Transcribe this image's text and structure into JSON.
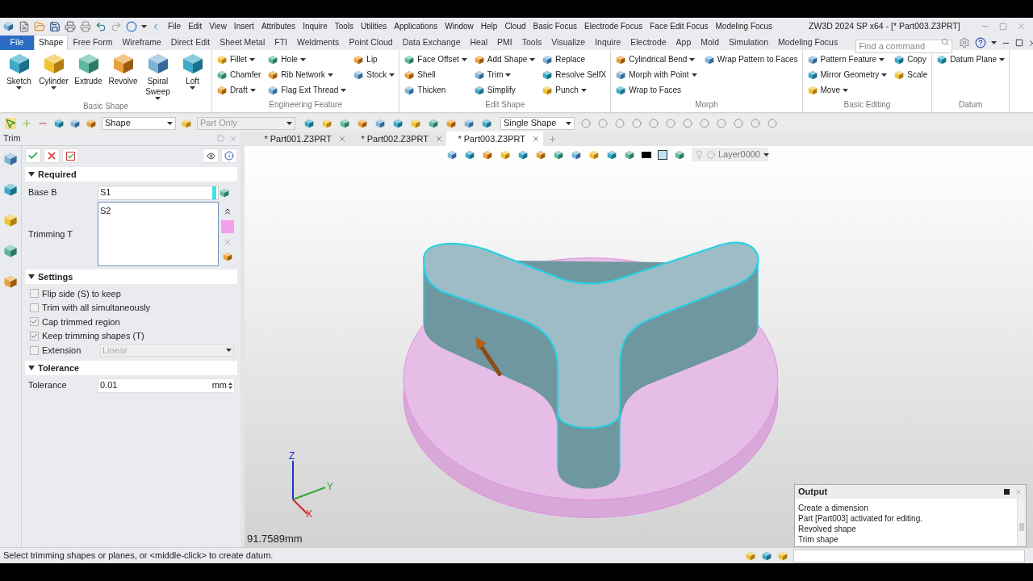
{
  "window": {
    "title": "ZW3D 2024 SP x64 - [* Part003.Z3PRT]"
  },
  "menu": [
    "File",
    "Edit",
    "View",
    "Insert",
    "Attributes",
    "Inquire",
    "Tools",
    "Utilities",
    "Applications",
    "Window",
    "Help",
    "Cloud",
    "Basic Focus",
    "Electrode Focus",
    "Face Edit Focus",
    "Modeling Focus"
  ],
  "ribbon_tabs": [
    {
      "label": "File",
      "kind": "app",
      "selected": false
    },
    {
      "label": "Shape",
      "kind": "tab",
      "selected": true
    },
    {
      "label": "Free Form",
      "kind": "tab",
      "selected": false
    },
    {
      "label": "Wireframe",
      "kind": "tab",
      "selected": false
    },
    {
      "label": "Direct Edit",
      "kind": "tab",
      "selected": false
    },
    {
      "label": "Sheet Metal",
      "kind": "tab",
      "selected": false
    },
    {
      "label": "FTI",
      "kind": "tab",
      "selected": false
    },
    {
      "label": "Weldments",
      "kind": "tab",
      "selected": false
    },
    {
      "label": "Point Cloud",
      "kind": "tab",
      "selected": false
    },
    {
      "label": "Data Exchange",
      "kind": "tab",
      "selected": false
    },
    {
      "label": "Heal",
      "kind": "tab",
      "selected": false
    },
    {
      "label": "PMI",
      "kind": "tab",
      "selected": false
    },
    {
      "label": "Tools",
      "kind": "tab",
      "selected": false
    },
    {
      "label": "Visualize",
      "kind": "tab",
      "selected": false
    },
    {
      "label": "Inquire",
      "kind": "tab",
      "selected": false
    },
    {
      "label": "Electrode",
      "kind": "tab",
      "selected": false
    },
    {
      "label": "App",
      "kind": "tab",
      "selected": false
    },
    {
      "label": "Mold",
      "kind": "tab",
      "selected": false
    },
    {
      "label": "Simulation",
      "kind": "tab",
      "selected": false
    },
    {
      "label": "Modeling Focus",
      "kind": "tab",
      "selected": false
    }
  ],
  "search": {
    "placeholder": "Find a command"
  },
  "ribbon_groups": [
    {
      "title": "Basic Shape",
      "kind": "large",
      "items": [
        {
          "label": "Sketch",
          "dropdown": true
        },
        {
          "label": "Cylinder",
          "dropdown": true
        },
        {
          "label": "Extrude",
          "dropdown": false
        },
        {
          "label": "Revolve",
          "dropdown": false
        },
        {
          "label": "Spiral Sweep",
          "dropdown": true
        },
        {
          "label": "Loft",
          "dropdown": true
        }
      ]
    },
    {
      "title": "Engineering Feature",
      "kind": "small",
      "columns": [
        [
          {
            "label": "Fillet",
            "dropdown": true
          },
          {
            "label": "Chamfer",
            "dropdown": false
          },
          {
            "label": "Draft",
            "dropdown": true
          }
        ],
        [
          {
            "label": "Hole",
            "dropdown": true
          },
          {
            "label": "Rib Network",
            "dropdown": true
          },
          {
            "label": "Flag Ext Thread",
            "dropdown": true
          }
        ],
        [
          {
            "label": "Lip",
            "dropdown": false
          },
          {
            "label": "Stock",
            "dropdown": true
          }
        ]
      ]
    },
    {
      "title": "Edit Shape",
      "kind": "small",
      "columns": [
        [
          {
            "label": "Face Offset",
            "dropdown": true
          },
          {
            "label": "Shell",
            "dropdown": false
          },
          {
            "label": "Thicken",
            "dropdown": false
          }
        ],
        [
          {
            "label": "Add Shape",
            "dropdown": true
          },
          {
            "label": "Trim",
            "dropdown": true
          },
          {
            "label": "Simplify",
            "dropdown": false
          }
        ],
        [
          {
            "label": "Replace",
            "dropdown": false
          },
          {
            "label": "Resolve SelfX",
            "dropdown": false
          },
          {
            "label": "Punch",
            "dropdown": true
          }
        ]
      ]
    },
    {
      "title": "Morph",
      "kind": "small",
      "columns": [
        [
          {
            "label": "Cylindrical Bend",
            "dropdown": true
          },
          {
            "label": "Morph with Point",
            "dropdown": true
          },
          {
            "label": "Wrap to Faces",
            "dropdown": false
          }
        ],
        [
          {
            "label": "Wrap Pattern to Faces",
            "dropdown": false
          }
        ]
      ]
    },
    {
      "title": "Basic Editing",
      "kind": "small",
      "columns": [
        [
          {
            "label": "Pattern Feature",
            "dropdown": true
          },
          {
            "label": "Mirror Geometry",
            "dropdown": true
          },
          {
            "label": "Move",
            "dropdown": true
          }
        ],
        [
          {
            "label": "Copy",
            "dropdown": false
          },
          {
            "label": "Scale",
            "dropdown": false
          }
        ]
      ]
    },
    {
      "title": "Datum",
      "kind": "small",
      "columns": [
        [
          {
            "label": "Datum Plane",
            "dropdown": true
          }
        ]
      ]
    }
  ],
  "toolbar": {
    "filters": [
      {
        "value": "Shape",
        "disabled": false
      },
      {
        "value": "Part Only",
        "disabled": true
      },
      {
        "value": "Single Shape",
        "disabled": false
      }
    ]
  },
  "panel": {
    "title": "Trim",
    "required": {
      "title": "Required",
      "expanded": true,
      "base": {
        "label": "Base B",
        "value": "S1"
      },
      "trimming": {
        "label": "Trimming T",
        "value": "S2"
      }
    },
    "settings": {
      "title": "Settings",
      "expanded": true,
      "options": [
        {
          "label": "Flip side (S) to keep",
          "checked": false
        },
        {
          "label": "Trim with all simultaneously",
          "checked": false
        },
        {
          "label": "Cap trimmed region",
          "checked": true
        },
        {
          "label": "Keep trimming shapes (T)",
          "checked": true
        }
      ],
      "extension": {
        "label": "Extension",
        "checked": false,
        "value": "Linear",
        "disabled": true
      }
    },
    "tolerance": {
      "title": "Tolerance",
      "expanded": true,
      "label": "Tolerance",
      "value": "0.01",
      "unit": "mm"
    }
  },
  "doc_tabs": [
    {
      "label": "* Part001.Z3PRT",
      "selected": false
    },
    {
      "label": "* Part002.Z3PRT",
      "selected": false
    },
    {
      "label": "* Part003.Z3PRT",
      "selected": true
    }
  ],
  "view_toolbar": {
    "layer": "Layer0000"
  },
  "viewport": {
    "dimension": "91.7589mm",
    "axes": [
      "X",
      "Y",
      "Z"
    ]
  },
  "output": {
    "title": "Output",
    "lines": [
      "Create a dimension",
      "Part [Part003] activated for editing.",
      "Revolved shape",
      "Trim shape"
    ]
  },
  "status_bar": {
    "message": "Select trimming shapes or planes, or <middle-click> to create datum."
  }
}
